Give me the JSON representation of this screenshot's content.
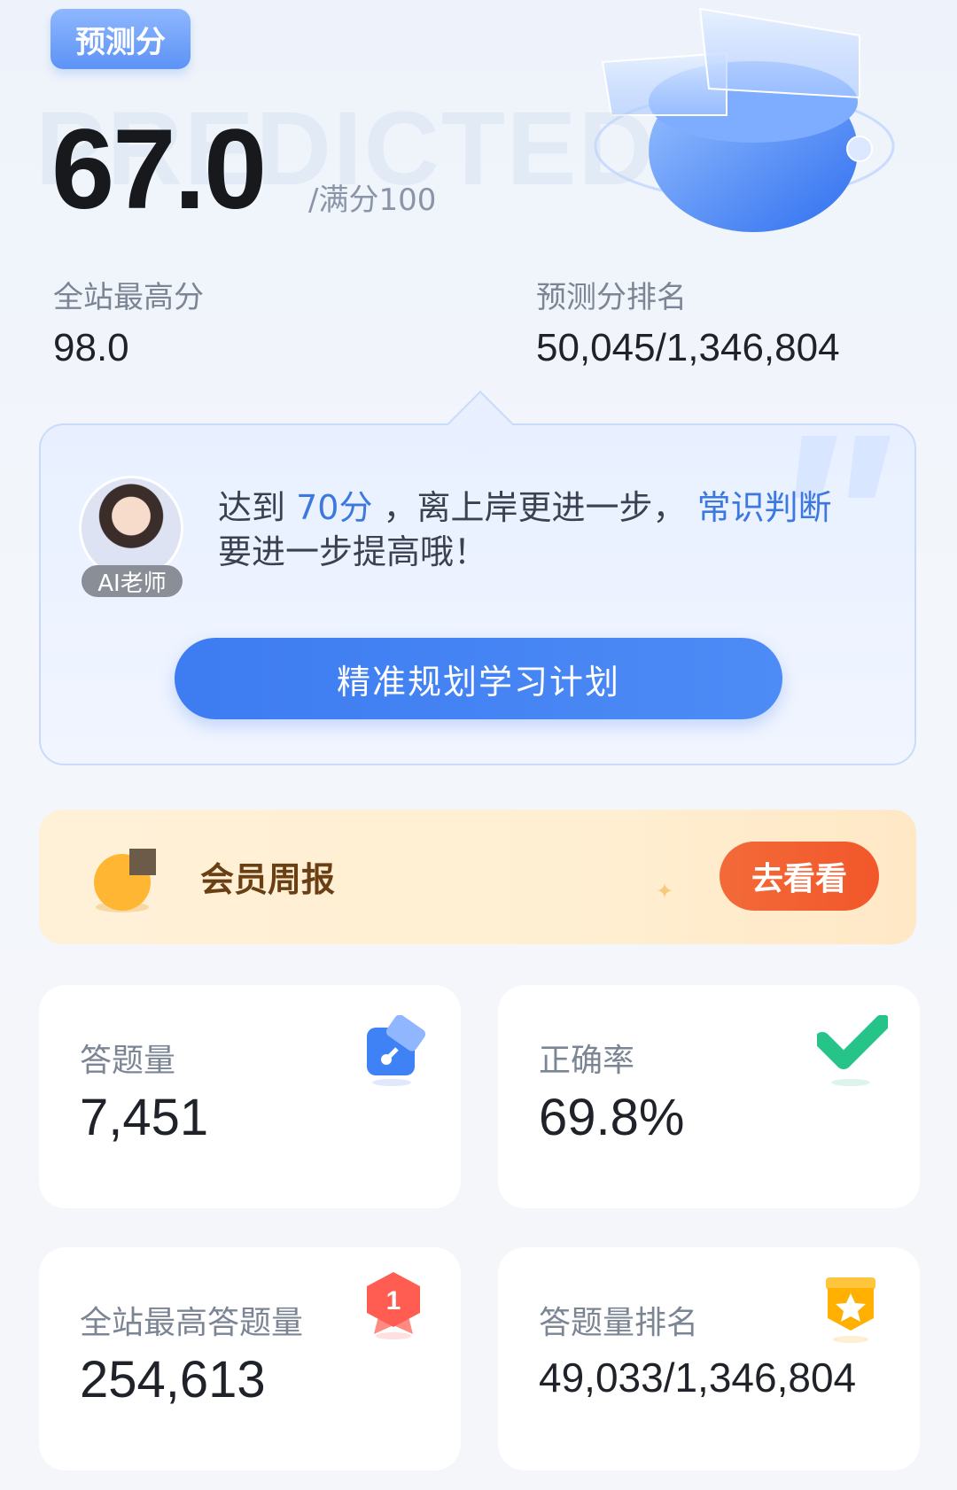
{
  "header": {
    "tag": "预测分",
    "watermark": "PREDICTED",
    "score": "67.0",
    "score_suffix": "/满分100"
  },
  "stats": {
    "site_high": {
      "label": "全站最高分",
      "value": "98.0"
    },
    "rank": {
      "label": "预测分排名",
      "value": "50,045/1,346,804"
    }
  },
  "ai": {
    "avatar_label": "AI老师",
    "text_pre": "达到 ",
    "text_target": "70分",
    "text_mid": " ，离上岸更进一步， ",
    "text_subject": "常识判断",
    "text_post": "要进一步提高哦！",
    "button": "精准规划学习计划"
  },
  "weekly": {
    "label": "会员周报",
    "button": "去看看"
  },
  "cards": {
    "answered": {
      "label": "答题量",
      "value": "7,451",
      "icon": "pencil-icon"
    },
    "accuracy": {
      "label": "正确率",
      "value": "69.8%",
      "icon": "check-icon"
    },
    "site_most": {
      "label": "全站最高答题量",
      "value": "254,613",
      "icon": "medal-icon"
    },
    "answered_rank": {
      "label": "答题量排名",
      "value": "49,033/1,346,804",
      "icon": "star-badge-icon"
    }
  },
  "colors": {
    "primary": "#3d7cf1",
    "highlight": "#3c78e0",
    "orange": "#f36a39",
    "card_bg": "#ffffff"
  }
}
